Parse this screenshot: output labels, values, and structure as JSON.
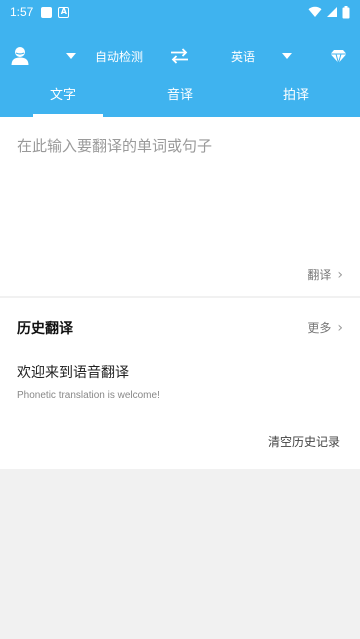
{
  "status_bar": {
    "time": "1:57",
    "icons": [
      "app-square-icon",
      "a-badge-icon",
      "wifi-icon",
      "signal-icon",
      "battery-icon"
    ]
  },
  "toolbar": {
    "source_language": "自动检测",
    "target_language": "英语",
    "icons": [
      "avatar-icon",
      "source-dropdown-icon",
      "swap-icon",
      "target-dropdown-icon",
      "vip-diamond-icon"
    ]
  },
  "tabs": [
    {
      "label": "文字",
      "active": true
    },
    {
      "label": "音译",
      "active": false
    },
    {
      "label": "拍译",
      "active": false
    }
  ],
  "input": {
    "placeholder": "在此输入要翻译的单词或句子",
    "translate_label": "翻译"
  },
  "history": {
    "title": "历史翻译",
    "more_label": "更多",
    "entries": [
      {
        "source": "欢迎来到语音翻译",
        "translation": "Phonetic translation is welcome!"
      }
    ],
    "clear_label": "清空历史记录"
  },
  "colors": {
    "header": "#3fb3ef",
    "background": "#f1f1f1",
    "card": "#ffffff"
  }
}
